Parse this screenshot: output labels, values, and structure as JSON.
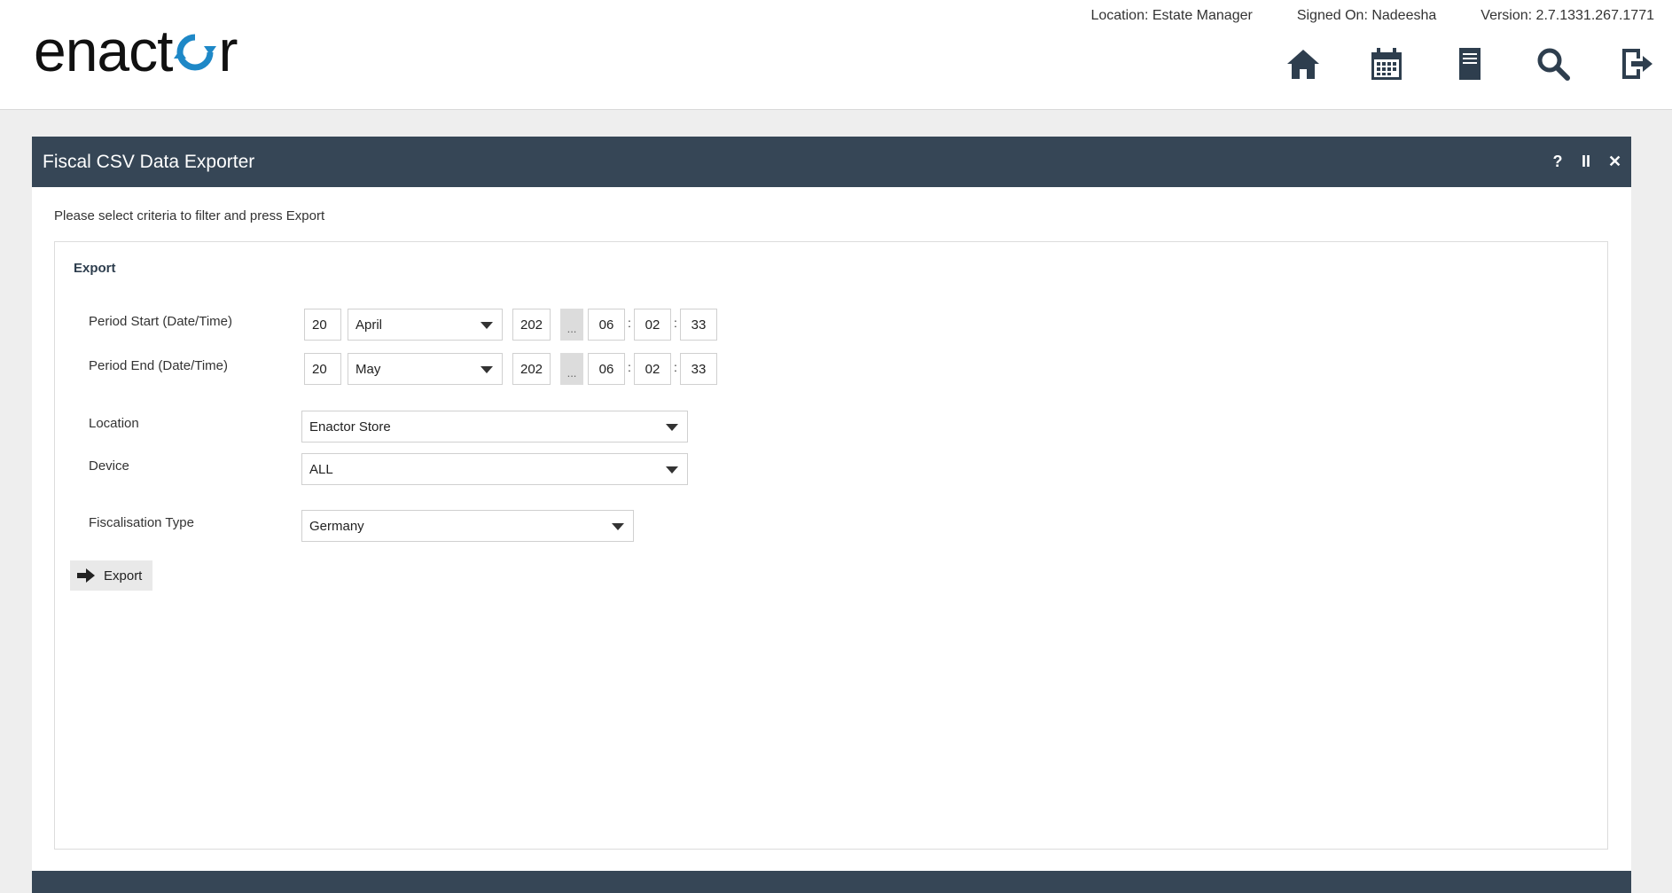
{
  "app": {
    "logo_text_before": "enact",
    "logo_text_after": "r"
  },
  "status": {
    "location": "Location: Estate Manager",
    "signed_on": "Signed On: Nadeesha",
    "version": "Version: 2.7.1331.267.1771"
  },
  "icons": [
    "home-icon",
    "calendar-icon",
    "notes-icon",
    "search-icon",
    "logout-icon"
  ],
  "panel": {
    "title": "Fiscal CSV Data Exporter",
    "help": "?",
    "pause": "II",
    "close": "✕",
    "instructions": "Please select criteria to filter and press Export",
    "fieldset_title": "Export"
  },
  "form": {
    "period_start": {
      "label": "Period Start (Date/Time)",
      "day": "20",
      "month": "April",
      "year": "202",
      "ellipsis": "...",
      "hour": "06",
      "minute": "02",
      "second": "33"
    },
    "period_end": {
      "label": "Period End (Date/Time)",
      "day": "20",
      "month": "May",
      "year": "202",
      "ellipsis": "...",
      "hour": "06",
      "minute": "02",
      "second": "33"
    },
    "time_separator": ":",
    "location": {
      "label": "Location",
      "value": "Enactor Store"
    },
    "device": {
      "label": "Device",
      "value": "ALL"
    },
    "fiscalisation_type": {
      "label": "Fiscalisation Type",
      "value": "Germany"
    },
    "export_label": "Export"
  },
  "colors": {
    "header_bg": "#364656",
    "icon_color": "#2e3e4e",
    "logo_accent": "#1e88c7"
  }
}
